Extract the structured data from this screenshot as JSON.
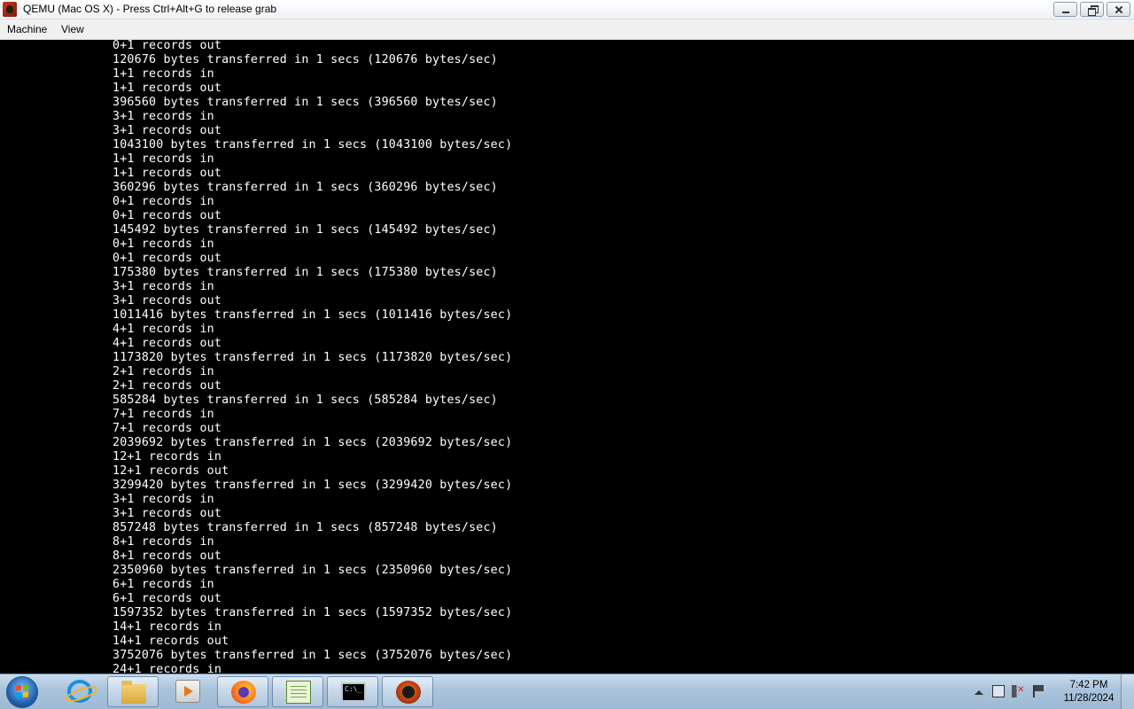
{
  "window": {
    "title": "QEMU (Mac OS X) - Press Ctrl+Alt+G to release grab"
  },
  "menu": {
    "items": [
      "Machine",
      "View"
    ]
  },
  "console": {
    "lines": [
      "0+1 records out",
      "120676 bytes transferred in 1 secs (120676 bytes/sec)",
      "1+1 records in",
      "1+1 records out",
      "396560 bytes transferred in 1 secs (396560 bytes/sec)",
      "3+1 records in",
      "3+1 records out",
      "1043100 bytes transferred in 1 secs (1043100 bytes/sec)",
      "1+1 records in",
      "1+1 records out",
      "360296 bytes transferred in 1 secs (360296 bytes/sec)",
      "0+1 records in",
      "0+1 records out",
      "145492 bytes transferred in 1 secs (145492 bytes/sec)",
      "0+1 records in",
      "0+1 records out",
      "175380 bytes transferred in 1 secs (175380 bytes/sec)",
      "3+1 records in",
      "3+1 records out",
      "1011416 bytes transferred in 1 secs (1011416 bytes/sec)",
      "4+1 records in",
      "4+1 records out",
      "1173820 bytes transferred in 1 secs (1173820 bytes/sec)",
      "2+1 records in",
      "2+1 records out",
      "585284 bytes transferred in 1 secs (585284 bytes/sec)",
      "7+1 records in",
      "7+1 records out",
      "2039692 bytes transferred in 1 secs (2039692 bytes/sec)",
      "12+1 records in",
      "12+1 records out",
      "3299420 bytes transferred in 1 secs (3299420 bytes/sec)",
      "3+1 records in",
      "3+1 records out",
      "857248 bytes transferred in 1 secs (857248 bytes/sec)",
      "8+1 records in",
      "8+1 records out",
      "2350960 bytes transferred in 1 secs (2350960 bytes/sec)",
      "6+1 records in",
      "6+1 records out",
      "1597352 bytes transferred in 1 secs (1597352 bytes/sec)",
      "14+1 records in",
      "14+1 records out",
      "3752076 bytes transferred in 1 secs (3752076 bytes/sec)",
      "24+1 records in"
    ]
  },
  "taskbar": {
    "apps": [
      {
        "name": "internet-explorer-icon",
        "active": false
      },
      {
        "name": "file-explorer-icon",
        "active": true
      },
      {
        "name": "media-player-icon",
        "active": false
      },
      {
        "name": "firefox-icon",
        "active": true
      },
      {
        "name": "notepad-plus-plus-icon",
        "active": true
      },
      {
        "name": "command-prompt-icon",
        "active": true
      },
      {
        "name": "qemu-icon",
        "active": true
      }
    ],
    "clock": {
      "time": "7:42 PM",
      "date": "11/28/2024"
    }
  }
}
